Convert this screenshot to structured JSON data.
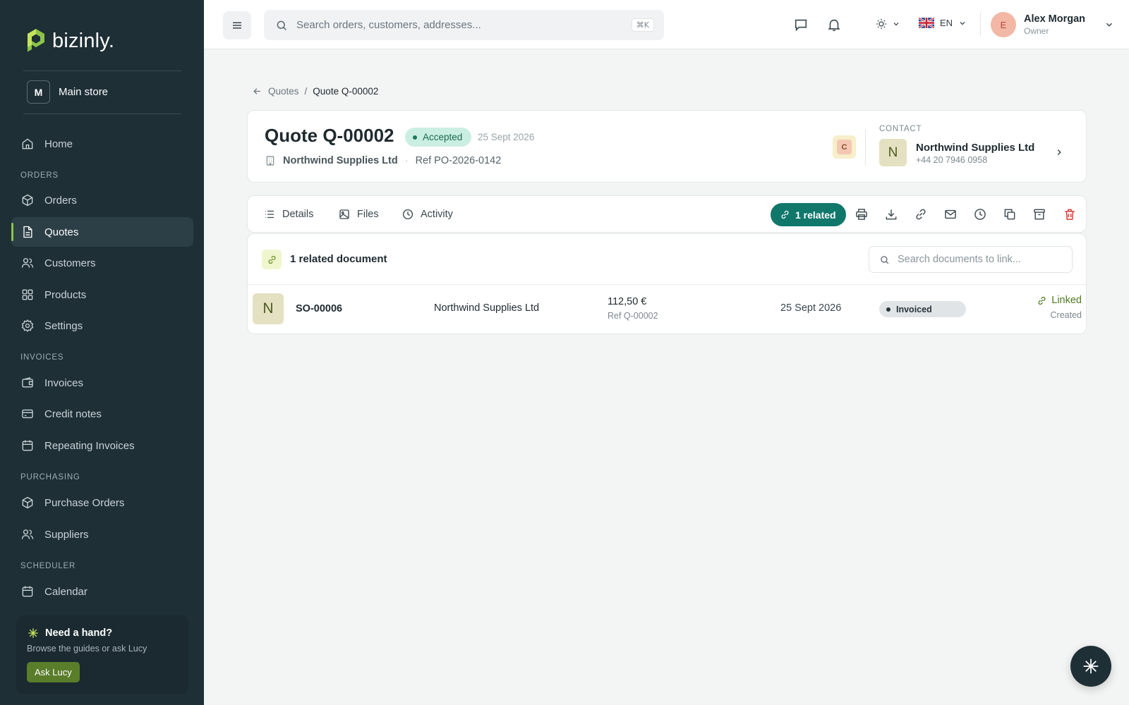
{
  "app": {
    "name": "bizinly."
  },
  "store": {
    "badge": "M",
    "name": "Main store"
  },
  "sidebar": {
    "home": "Home",
    "sections": {
      "orders": "ORDERS",
      "invoices": "INVOICES",
      "purchasing": "PURCHASING",
      "scheduler": "SCHEDULER"
    },
    "items": {
      "orders": "Orders",
      "quotes": "Quotes",
      "customers": "Customers",
      "products": "Products",
      "settings": "Settings",
      "invoices": "Invoices",
      "credit_notes": "Credit notes",
      "repeating_invoices": "Repeating Invoices",
      "purchase_orders": "Purchase Orders",
      "suppliers": "Suppliers",
      "calendar": "Calendar"
    },
    "active": "quotes",
    "help": {
      "title": "Need a hand?",
      "subtitle": "Browse the guides or ask Lucy",
      "button": "Ask Lucy"
    }
  },
  "topbar": {
    "search_placeholder": "Search orders, customers, addresses...",
    "shortcut": "⌘K",
    "language": "EN",
    "user": {
      "initial": "E",
      "name": "Alex Morgan",
      "role": "Owner"
    }
  },
  "breadcrumb": {
    "parent": "Quotes",
    "separator": "/",
    "current": "Quote Q-00002"
  },
  "quote": {
    "title": "Quote Q-00002",
    "status": "Accepted",
    "date": "25 Sept 2026",
    "company": "Northwind Supplies Ltd",
    "separator": "·",
    "reference": "Ref PO-2026-0142",
    "badge": "C"
  },
  "contact": {
    "label": "CONTACT",
    "initial": "N",
    "name": "Northwind Supplies Ltd",
    "phone": "+44 20 7946 0958"
  },
  "tabs": {
    "details": "Details",
    "files": "Files",
    "activity": "Activity"
  },
  "toolbar": {
    "related": "1 related"
  },
  "related": {
    "title": "1 related document",
    "search_placeholder": "Search documents to link...",
    "rows": [
      {
        "initial": "N",
        "number": "SO-00006",
        "customer": "Northwind Supplies Ltd",
        "amount": "112,50 €",
        "reference": "Ref Q-00002",
        "date": "25 Sept 2026",
        "status": "Invoiced",
        "link_label": "Linked",
        "link_sub": "Created"
      }
    ]
  },
  "colors": {
    "sidebar_bg": "#1e2f36",
    "accent": "#10776b",
    "accepted_bg": "#cbeee2",
    "delete": "#d93b3b",
    "brand_green": "#8bc34a"
  }
}
